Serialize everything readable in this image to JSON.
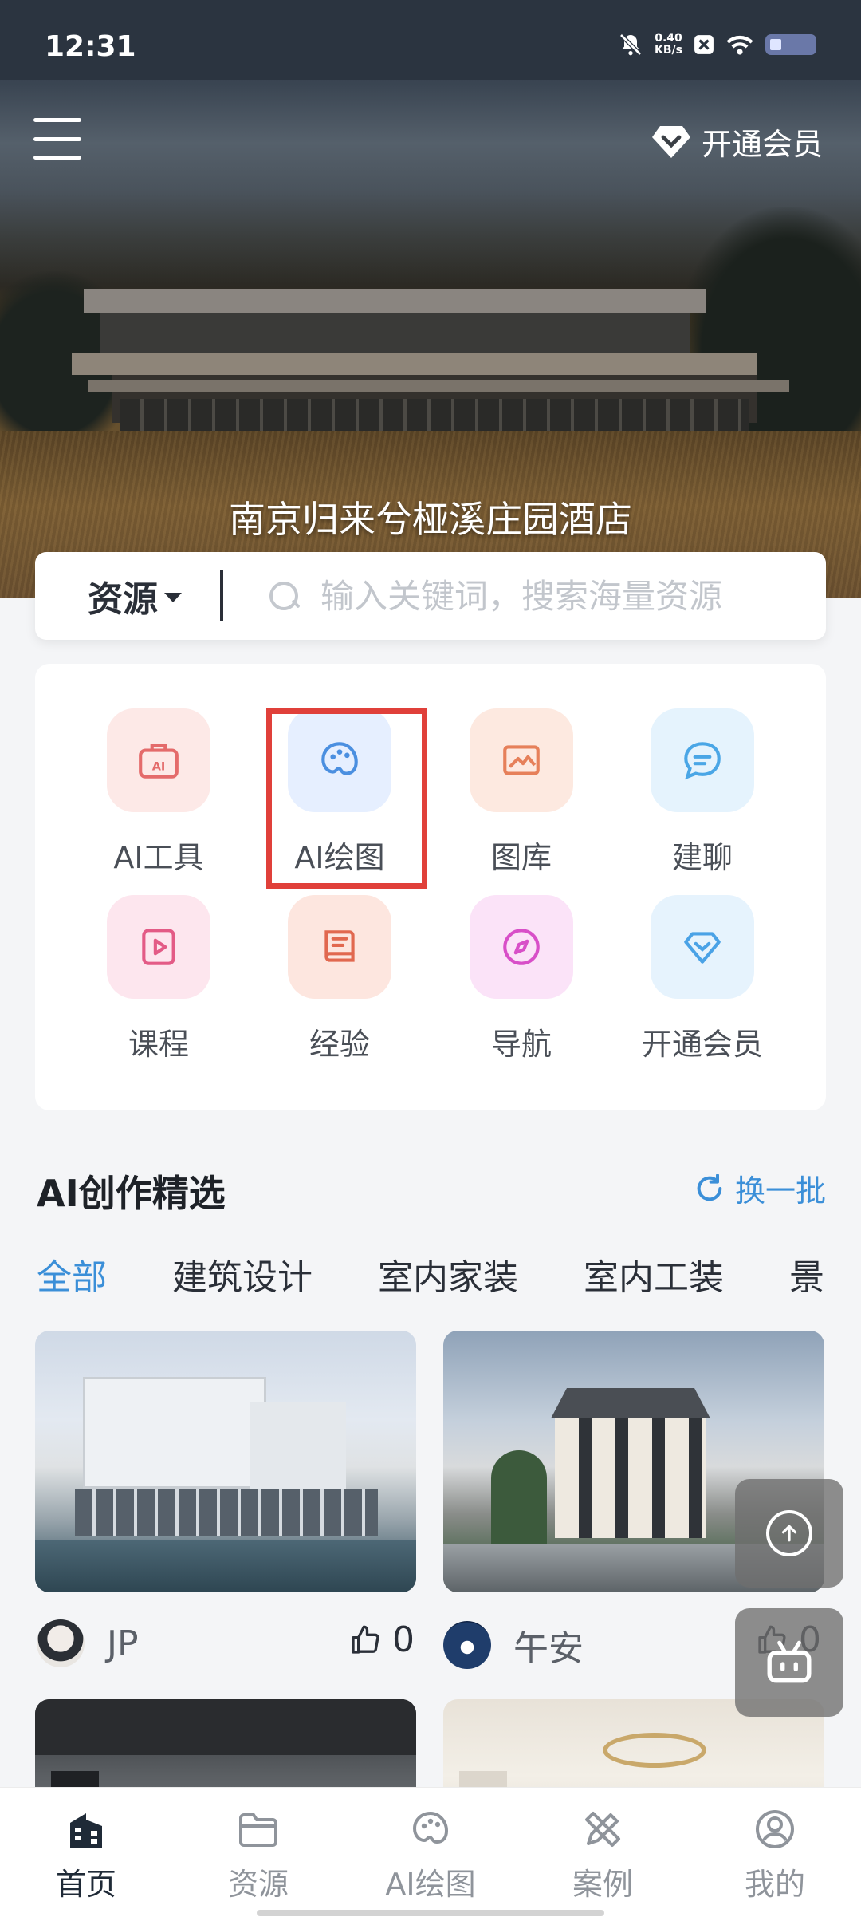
{
  "status_bar": {
    "time": "12:31",
    "net_speed_value": "0.40",
    "net_speed_unit": "KB/s"
  },
  "header": {
    "member_label": "开通会员"
  },
  "hero": {
    "title": "南京归来兮桠溪庄园酒店"
  },
  "search": {
    "scope": "资源",
    "placeholder": "输入关键词，搜索海量资源"
  },
  "grid": {
    "items": [
      {
        "label": "AI工具",
        "icon": "ai-toolbox-icon",
        "color": "#e46b6b",
        "bg": "#fde9e7"
      },
      {
        "label": "AI绘图",
        "icon": "palette-icon",
        "color": "#4b8fe0",
        "bg": "#e6efff"
      },
      {
        "label": "图库",
        "icon": "picture-icon",
        "color": "#e6805a",
        "bg": "#fde9e0"
      },
      {
        "label": "建聊",
        "icon": "chat-bubble-icon",
        "color": "#4aa6e6",
        "bg": "#e5f3fd"
      },
      {
        "label": "课程",
        "icon": "video-play-icon",
        "color": "#e35b86",
        "bg": "#fde6ee"
      },
      {
        "label": "经验",
        "icon": "book-icon",
        "color": "#e1684f",
        "bg": "#fde6df"
      },
      {
        "label": "导航",
        "icon": "compass-icon",
        "color": "#d84fc8",
        "bg": "#fbe3f8"
      },
      {
        "label": "开通会员",
        "icon": "diamond-icon",
        "color": "#4aa2e6",
        "bg": "#e6f3fd"
      }
    ],
    "highlight_color": "#e0403a"
  },
  "section": {
    "title": "AI创作精选",
    "refresh_label": "换一批",
    "tabs": [
      "全部",
      "建筑设计",
      "室内家装",
      "室内工装",
      "景"
    ]
  },
  "cards": [
    {
      "author": "JP",
      "likes": "0"
    },
    {
      "author": "午安",
      "likes": "0"
    }
  ],
  "bottom_nav": {
    "items": [
      {
        "label": "首页",
        "icon": "home-building-icon"
      },
      {
        "label": "资源",
        "icon": "folder-icon"
      },
      {
        "label": "AI绘图",
        "icon": "palette-icon"
      },
      {
        "label": "案例",
        "icon": "pencil-ruler-icon"
      },
      {
        "label": "我的",
        "icon": "user-icon"
      }
    ],
    "active_index": 0
  },
  "colors": {
    "accent": "#3b8fd8",
    "status_bar": "#2b3440"
  }
}
